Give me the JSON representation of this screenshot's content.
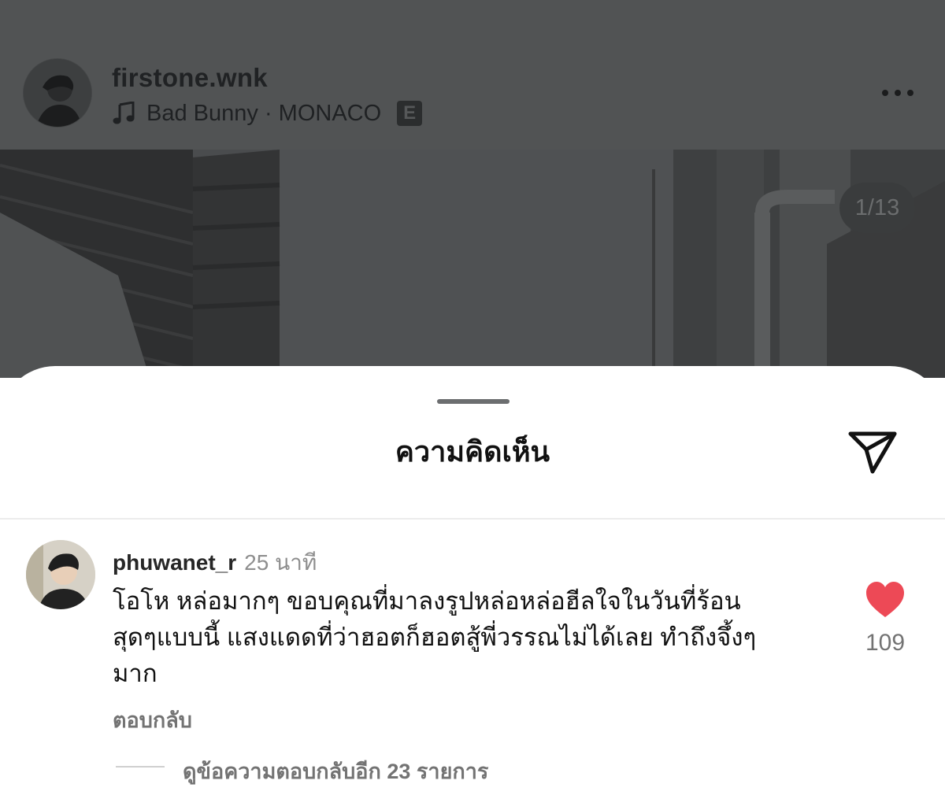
{
  "post": {
    "username": "firstone.wnk",
    "music": {
      "artist_track": "Bad Bunny · MONACO",
      "explicit_badge": "E",
      "icon": "music-note-icon"
    },
    "more_icon": "more-horizontal-icon",
    "image_counter": "1/13"
  },
  "comments_sheet": {
    "title": "ความคิดเห็น",
    "share_icon": "send-icon",
    "comment": {
      "username": "phuwanet_r",
      "time": "25 นาที",
      "lines": [
        "โอโห หล่อมากๆ ขอบคุณที่มาลงรูปหล่อหล่อฮีลใจในวันที่ร้อน",
        "สุดๆแบบนี้ แสงแดดที่ว่าฮอตก็ฮอตสู้พี่วรรณไม่ได้เลย ทำถึงจึ้งๆ",
        "มาก"
      ],
      "reply_label": "ตอบกลับ",
      "like_icon": "heart-icon",
      "like_color": "#ed4956",
      "like_count": "109"
    },
    "view_more_replies": "ดูข้อความตอบกลับอีก 23 รายการ"
  }
}
